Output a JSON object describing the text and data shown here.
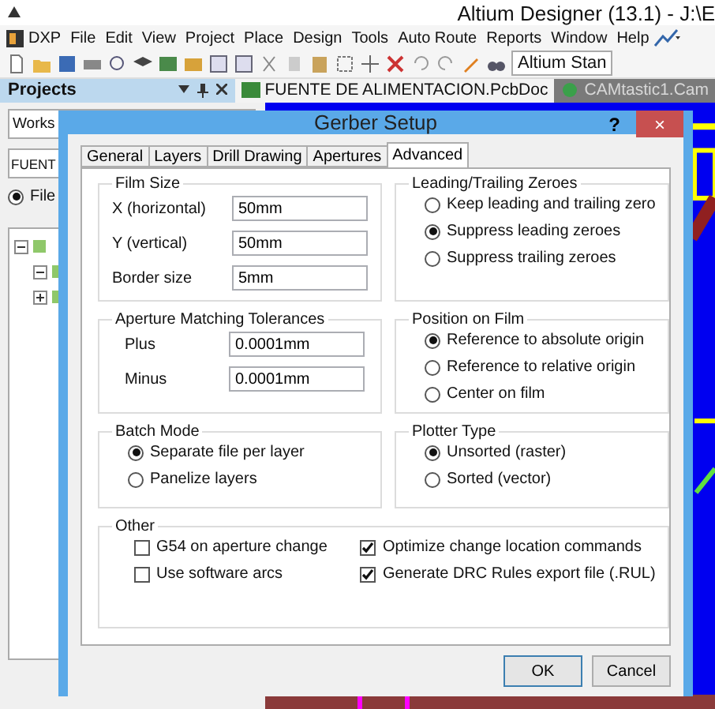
{
  "app": {
    "title": "Altium Designer (13.1) - J:\\E",
    "menu": [
      "DXP",
      "File",
      "Edit",
      "View",
      "Project",
      "Place",
      "Design",
      "Tools",
      "Auto Route",
      "Reports",
      "Window",
      "Help"
    ],
    "toolbar_field": "Altium Stan"
  },
  "projects_panel": {
    "title": "Projects",
    "workspace": "Works",
    "project": "FUENT",
    "view_option": {
      "label": "File",
      "selected": true
    },
    "tree": [
      {
        "expanded": true,
        "children": [
          {
            "expanded": true
          },
          {
            "expanded": false
          }
        ]
      }
    ]
  },
  "documents": [
    {
      "label": "FUENTE DE ALIMENTACION.PcbDoc",
      "selected": true
    },
    {
      "label": "CAMtastic1.Cam",
      "selected": false
    }
  ],
  "dialog": {
    "title": "Gerber Setup",
    "help": "?",
    "close": "×",
    "tabs": [
      {
        "label": "General",
        "selected": false
      },
      {
        "label": "Layers",
        "selected": false
      },
      {
        "label": "Drill Drawing",
        "selected": false
      },
      {
        "label": "Apertures",
        "selected": false
      },
      {
        "label": "Advanced",
        "selected": true
      }
    ],
    "groups": [
      {
        "title": "Film Size",
        "kind": "fields",
        "items": [
          {
            "label": "X (horizontal)",
            "value": "50mm"
          },
          {
            "label": "Y (vertical)",
            "value": "50mm"
          },
          {
            "label": "Border size",
            "value": "5mm"
          }
        ]
      },
      {
        "title": "Leading/Trailing Zeroes",
        "kind": "radios",
        "items": [
          {
            "label": "Keep leading and trailing zero",
            "selected": false
          },
          {
            "label": "Suppress leading zeroes",
            "selected": true
          },
          {
            "label": "Suppress trailing zeroes",
            "selected": false
          }
        ]
      },
      {
        "title": "Aperture Matching Tolerances",
        "kind": "fields",
        "items": [
          {
            "label": "Plus",
            "value": "0.0001mm"
          },
          {
            "label": "Minus",
            "value": "0.0001mm"
          }
        ]
      },
      {
        "title": "Position on Film",
        "kind": "radios",
        "items": [
          {
            "label": "Reference to absolute origin",
            "selected": true
          },
          {
            "label": "Reference to relative origin",
            "selected": false
          },
          {
            "label": "Center on film",
            "selected": false
          }
        ]
      },
      {
        "title": "Batch Mode",
        "kind": "radios",
        "items": [
          {
            "label": "Separate file per layer",
            "selected": true
          },
          {
            "label": "Panelize layers",
            "selected": false
          }
        ]
      },
      {
        "title": "Plotter Type",
        "kind": "radios",
        "items": [
          {
            "label": "Unsorted (raster)",
            "selected": true
          },
          {
            "label": "Sorted (vector)",
            "selected": false
          }
        ]
      }
    ],
    "other": {
      "title": "Other",
      "items": [
        {
          "label": "G54 on aperture change",
          "checked": false
        },
        {
          "label": "Optimize change location commands",
          "checked": true
        },
        {
          "label": "Use software arcs",
          "checked": false
        },
        {
          "label": "Generate DRC Rules export file (.RUL)",
          "checked": true
        }
      ]
    },
    "buttons": [
      {
        "label": "OK",
        "kind": "default"
      },
      {
        "label": "Cancel",
        "kind": "normal"
      }
    ]
  }
}
